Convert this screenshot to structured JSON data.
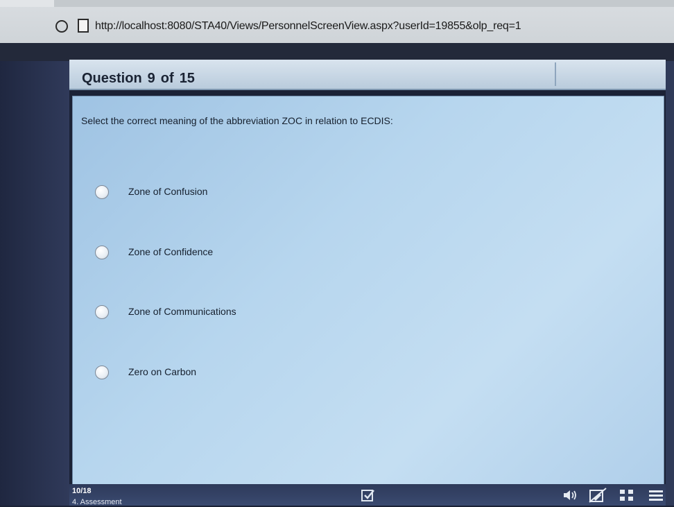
{
  "browser": {
    "url": "http://localhost:8080/STA40/Views/PersonnelScreenView.aspx?userId=19855&olp_req=1"
  },
  "question_header": {
    "prefix": "Question",
    "number": "9",
    "of_label": "of",
    "total": "15"
  },
  "question": {
    "text": "Select the correct meaning of the abbreviation ZOC in relation to ECDIS:",
    "options": [
      {
        "label": "Zone of Confusion"
      },
      {
        "label": "Zone of Confidence"
      },
      {
        "label": "Zone of Communications"
      },
      {
        "label": "Zero on Carbon"
      }
    ]
  },
  "footer": {
    "progress": "10/18",
    "section": "4. Assessment",
    "icons": [
      "review-icon",
      "sound-icon",
      "flag-icon",
      "grid-icon",
      "menu-icon"
    ]
  }
}
